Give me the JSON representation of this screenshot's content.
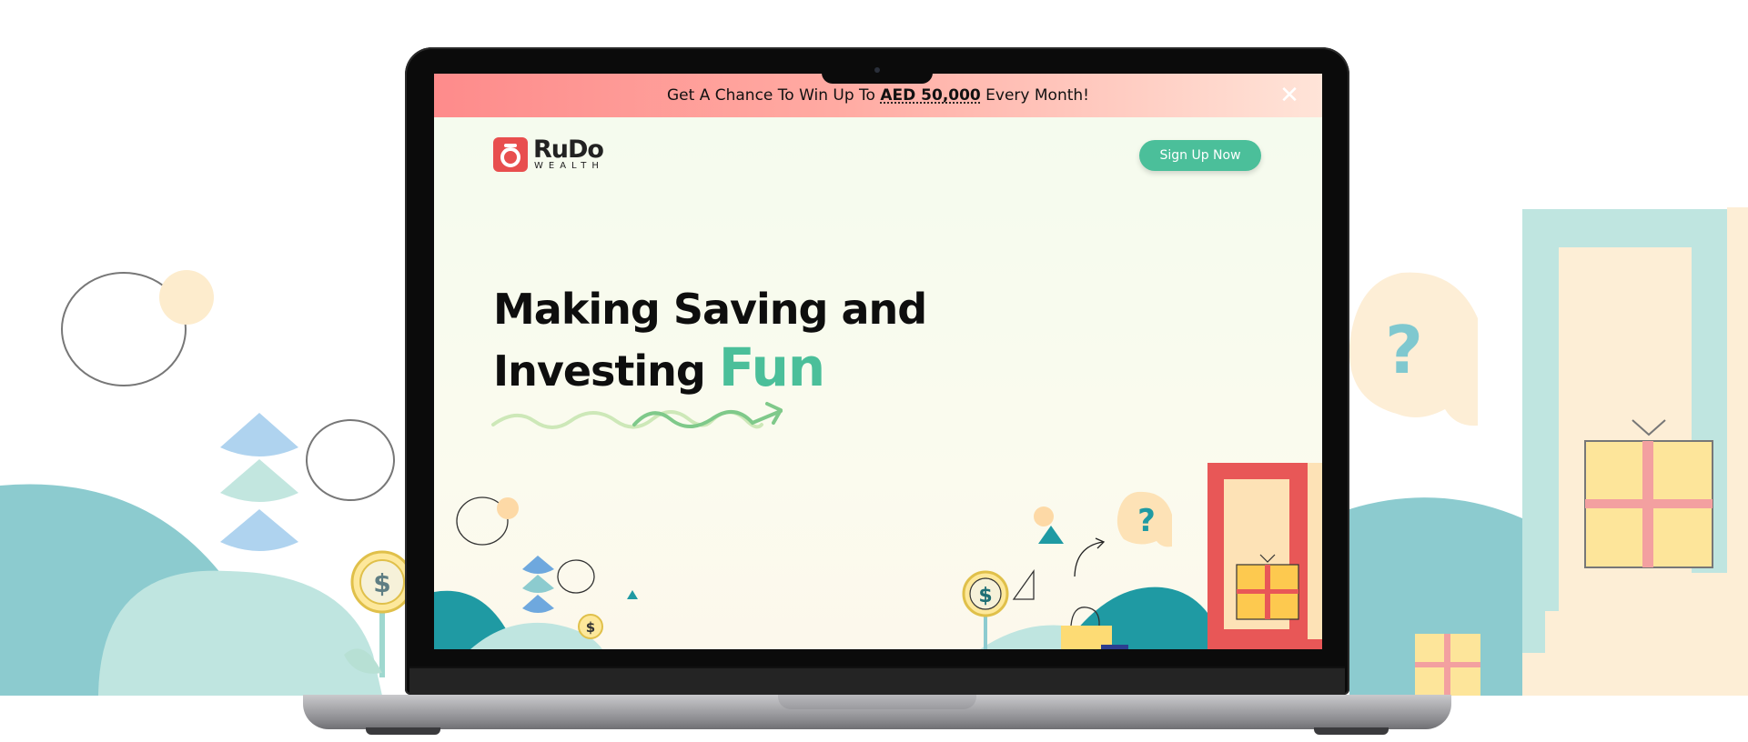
{
  "banner": {
    "prefix": "Get A Chance To Win Up To ",
    "amount": "AED 50,000",
    "suffix": " Every Month!",
    "close_icon": "close-icon"
  },
  "logo": {
    "name": "RuDo",
    "subtitle": "WEALTH"
  },
  "header": {
    "signup_label": "Sign Up Now"
  },
  "hero": {
    "line1": "Making Saving and",
    "line2": "Investing ",
    "highlight": "Fun"
  },
  "decor": {
    "question_mark": "?",
    "dollar": "$"
  },
  "colors": {
    "accent_green": "#4bbf9a",
    "brand_red": "#e84e4e",
    "banner_pink": "#fe8b8b",
    "teal": "#1f9aa3"
  }
}
